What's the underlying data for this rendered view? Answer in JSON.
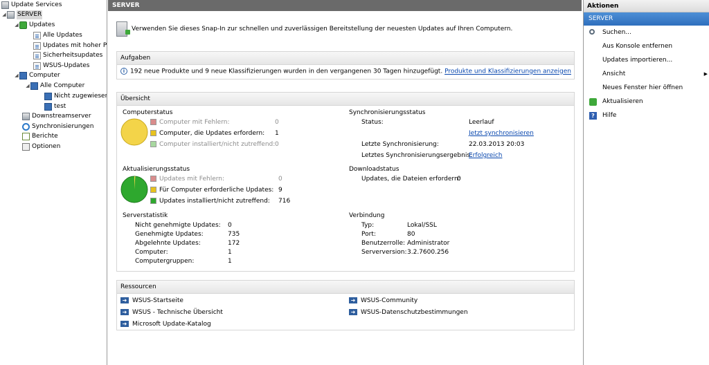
{
  "tree": {
    "items": [
      {
        "label": "Update Services",
        "name": "tree-update-services",
        "icon": "server-icon"
      },
      {
        "label": "SERVER",
        "name": "tree-server",
        "icon": "server-icon"
      },
      {
        "label": "Updates",
        "name": "tree-updates",
        "icon": "updates-icon"
      },
      {
        "label": "Alle Updates",
        "name": "tree-alle-updates",
        "icon": "document-icon"
      },
      {
        "label": "Updates mit hoher Pr",
        "name": "tree-updates-hoher-prioritaet",
        "icon": "document-icon"
      },
      {
        "label": "Sicherheitsupdates",
        "name": "tree-sicherheitsupdates",
        "icon": "document-icon"
      },
      {
        "label": "WSUS-Updates",
        "name": "tree-wsus-updates",
        "icon": "document-icon"
      },
      {
        "label": "Computer",
        "name": "tree-computer",
        "icon": "computer-icon"
      },
      {
        "label": "Alle Computer",
        "name": "tree-alle-computer",
        "icon": "computer-icon"
      },
      {
        "label": "Nicht zugewiesen",
        "name": "tree-nicht-zugewiesen",
        "icon": "computer-icon"
      },
      {
        "label": "test",
        "name": "tree-test",
        "icon": "computer-icon"
      },
      {
        "label": "Downstreamserver",
        "name": "tree-downstreamserver",
        "icon": "server-icon"
      },
      {
        "label": "Synchronisierungen",
        "name": "tree-synchronisierungen",
        "icon": "sync-icon"
      },
      {
        "label": "Berichte",
        "name": "tree-berichte",
        "icon": "report-icon"
      },
      {
        "label": "Optionen",
        "name": "tree-optionen",
        "icon": "options-icon"
      }
    ]
  },
  "center": {
    "title": "SERVER",
    "intro": "Verwenden Sie dieses Snap-In zur schnellen und zuverlässigen Bereitstellung der neuesten Updates auf Ihren Computern.",
    "aufgaben": {
      "title": "Aufgaben",
      "message": "192 neue Produkte und 9 neue Klassifizierungen wurden in den vergangenen 30 Tagen hinzugefügt.",
      "link": "Produkte und Klassifizierungen anzeigen"
    },
    "uebersicht": {
      "title": "Übersicht",
      "computerstatus": {
        "title": "Computerstatus",
        "rows": [
          {
            "label": "Computer mit Fehlern:",
            "value": "0",
            "color": "#d98c8c",
            "dim": true
          },
          {
            "label": "Computer, die Updates erfordern:",
            "value": "1",
            "color": "#e8c21e",
            "dim": false
          },
          {
            "label": "Computer installiert/nicht zutreffend:",
            "value": "0",
            "color": "#a8d8a0",
            "dim": true
          }
        ]
      },
      "aktualisierungsstatus": {
        "title": "Aktualisierungsstatus",
        "rows": [
          {
            "label": "Updates mit Fehlern:",
            "value": "0",
            "color": "#d98c8c",
            "dim": true
          },
          {
            "label": "Für Computer erforderliche Updates:",
            "value": "9",
            "color": "#e8c21e",
            "dim": false
          },
          {
            "label": "Updates installiert/nicht zutreffend:",
            "value": "716",
            "color": "#2ea82e",
            "dim": false
          }
        ]
      },
      "serverstatistik": {
        "title": "Serverstatistik",
        "rows": [
          {
            "label": "Nicht genehmigte Updates:",
            "value": "0"
          },
          {
            "label": "Genehmigte Updates:",
            "value": "735"
          },
          {
            "label": "Abgelehnte Updates:",
            "value": "172"
          },
          {
            "label": "Computer:",
            "value": "1"
          },
          {
            "label": "Computergruppen:",
            "value": "1"
          }
        ]
      },
      "sync": {
        "title": "Synchronisierungsstatus",
        "status_label": "Status:",
        "status_value": "Leerlauf",
        "sync_now": "Jetzt synchronisieren",
        "last_sync_label": "Letzte Synchronisierung:",
        "last_sync_value": "22.03.2013 20:03",
        "last_result_label": "Letztes Synchronisierungsergebnis:",
        "last_result_value": "Erfolgreich"
      },
      "download": {
        "title": "Downloadstatus",
        "label": "Updates, die Dateien erfordern:",
        "value": "0"
      },
      "verbindung": {
        "title": "Verbindung",
        "rows": [
          {
            "label": "Typ:",
            "value": "Lokal/SSL"
          },
          {
            "label": "Port:",
            "value": "80"
          },
          {
            "label": "Benutzerrolle:",
            "value": "Administrator"
          },
          {
            "label": "Serverversion:",
            "value": "3.2.7600.256"
          }
        ]
      }
    },
    "ressourcen": {
      "title": "Ressourcen",
      "left": [
        "WSUS-Startseite",
        "WSUS - Technische Übersicht",
        "Microsoft Update-Katalog"
      ],
      "right": [
        "WSUS-Community",
        "WSUS-Datenschutzbestimmungen"
      ]
    }
  },
  "actions": {
    "title": "Aktionen",
    "subtitle": "SERVER",
    "items": [
      {
        "label": "Suchen...",
        "name": "action-suchen",
        "icon": "search-icon"
      },
      {
        "label": "Aus Konsole entfernen",
        "name": "action-aus-konsole-entfernen",
        "icon": ""
      },
      {
        "label": "Updates importieren...",
        "name": "action-updates-importieren",
        "icon": ""
      },
      {
        "label": "Ansicht",
        "name": "action-ansicht",
        "icon": "",
        "submenu": true
      },
      {
        "label": "Neues Fenster hier öffnen",
        "name": "action-neues-fenster",
        "icon": ""
      },
      {
        "label": "Aktualisieren",
        "name": "action-aktualisieren",
        "icon": "refresh-icon"
      },
      {
        "label": "Hilfe",
        "name": "action-hilfe",
        "icon": "help-icon"
      }
    ]
  },
  "colors": {
    "header_bg": "#6a6a6a",
    "actions_sub_bg": "#2f6fbd",
    "link": "#0645ad",
    "pie_yellow": "#f3d449",
    "pie_green": "#2ea82e"
  }
}
